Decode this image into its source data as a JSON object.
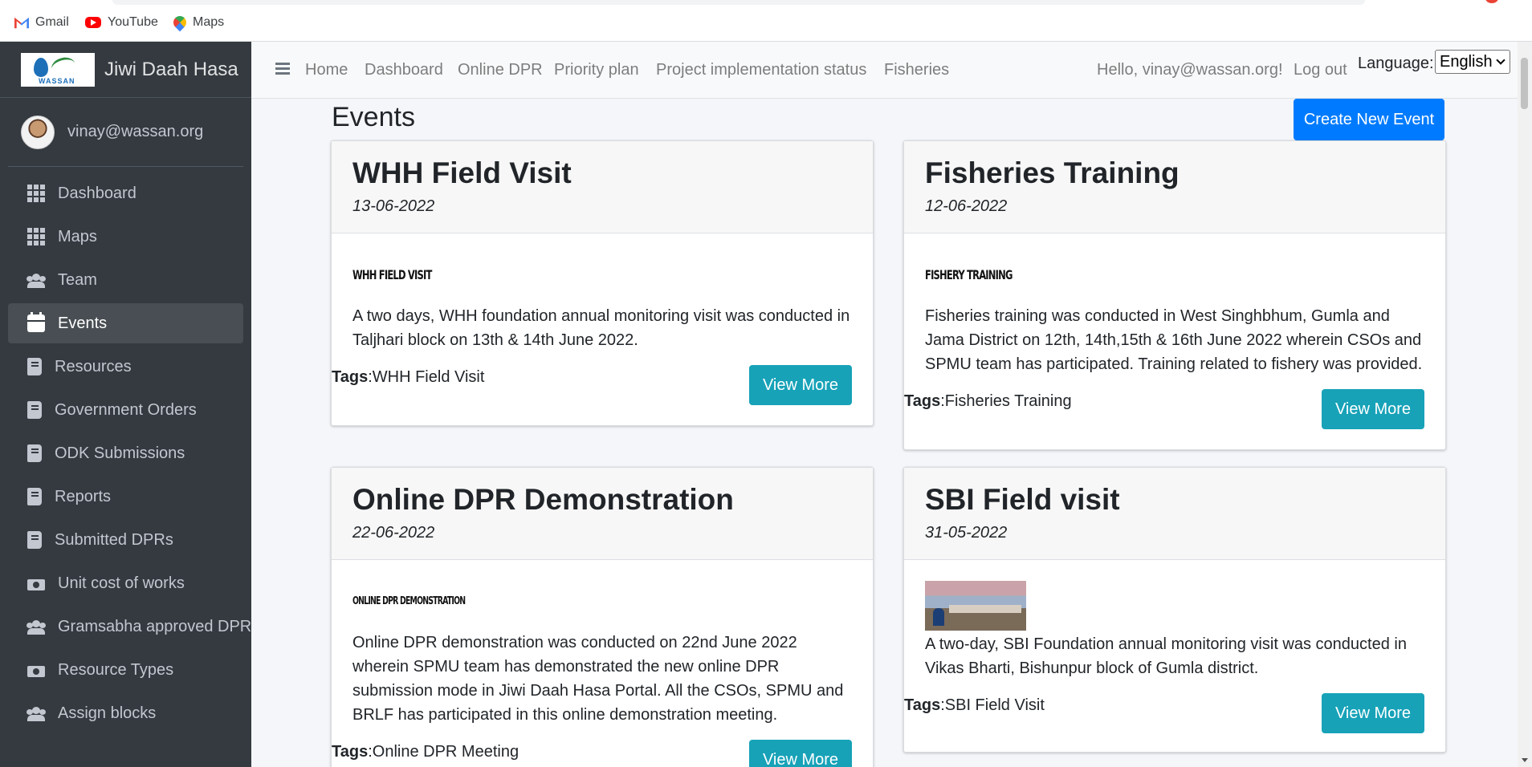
{
  "bookmarks": [
    {
      "label": "Gmail",
      "icon": "gmail-icon"
    },
    {
      "label": "YouTube",
      "icon": "youtube-icon"
    },
    {
      "label": "Maps",
      "icon": "maps-icon"
    }
  ],
  "brand": {
    "logo_text": "WASSAN",
    "title": "Jiwi Daah Hasa"
  },
  "user": {
    "name": "vinay@wassan.org"
  },
  "sidebar": {
    "items": [
      {
        "label": "Dashboard",
        "icon": "grid-icon"
      },
      {
        "label": "Maps",
        "icon": "grid-icon"
      },
      {
        "label": "Team",
        "icon": "users-icon"
      },
      {
        "label": "Events",
        "icon": "calendar-icon",
        "active": true
      },
      {
        "label": "Resources",
        "icon": "book-icon"
      },
      {
        "label": "Government Orders",
        "icon": "book-icon"
      },
      {
        "label": "ODK Submissions",
        "icon": "book-icon"
      },
      {
        "label": "Reports",
        "icon": "book-icon"
      },
      {
        "label": "Submitted DPRs",
        "icon": "book-icon"
      },
      {
        "label": "Unit cost of works",
        "icon": "money-icon"
      },
      {
        "label": "Gramsabha approved DPR",
        "icon": "users-icon"
      },
      {
        "label": "Resource Types",
        "icon": "money-icon"
      },
      {
        "label": "Assign blocks",
        "icon": "users-icon"
      }
    ]
  },
  "topnav": {
    "links": [
      "Home",
      "Dashboard",
      "Online DPR",
      "Priority plan",
      "Project implementation status",
      "Fisheries"
    ],
    "greeting": "Hello, vinay@wassan.org!",
    "logout": "Log out",
    "language_label": "Language:",
    "language_value": "English"
  },
  "page": {
    "title": "Events",
    "create_button": "Create New Event"
  },
  "events": [
    {
      "title": "WHH Field Visit",
      "date": "13-06-2022",
      "image_text": "WHH FIELD VISIT",
      "description": "A two days, WHH foundation annual monitoring visit was conducted in Taljhari block on 13th & 14th June 2022.",
      "tags_label": "Tags",
      "tags": "WHH Field Visit",
      "button": "View More"
    },
    {
      "title": "Fisheries Training",
      "date": "12-06-2022",
      "image_text": "FISHERY TRAINING",
      "description": "Fisheries training was conducted in West Singhbhum, Gumla and Jama District on 12th, 14th,15th & 16th June 2022 wherein CSOs and SPMU team has participated. Training related to fishery was provided.",
      "tags_label": "Tags",
      "tags": "Fisheries Training",
      "button": "View More"
    },
    {
      "title": "Online DPR Demonstration",
      "date": "22-06-2022",
      "image_text": "ONLINE DPR DEMONSTRATION",
      "description": "Online DPR demonstration was conducted on 22nd June 2022 wherein SPMU team has demonstrated the new online DPR submission mode in Jiwi Daah Hasa Portal. All the CSOs, SPMU and BRLF has participated in this online demonstration meeting.",
      "tags_label": "Tags",
      "tags": "Online DPR Meeting",
      "button": "View More"
    },
    {
      "title": "SBI Field visit",
      "date": "31-05-2022",
      "image_text": "",
      "description": "A two-day, SBI Foundation annual monitoring visit was conducted in Vikas Bharti, Bishunpur block of Gumla district.",
      "tags_label": "Tags",
      "tags": "SBI Field Visit",
      "button": "View More"
    }
  ],
  "colors": {
    "sidebar_bg": "#343a40",
    "primary": "#007bff",
    "info": "#17a2b8",
    "content_bg": "#f4f6f9"
  }
}
